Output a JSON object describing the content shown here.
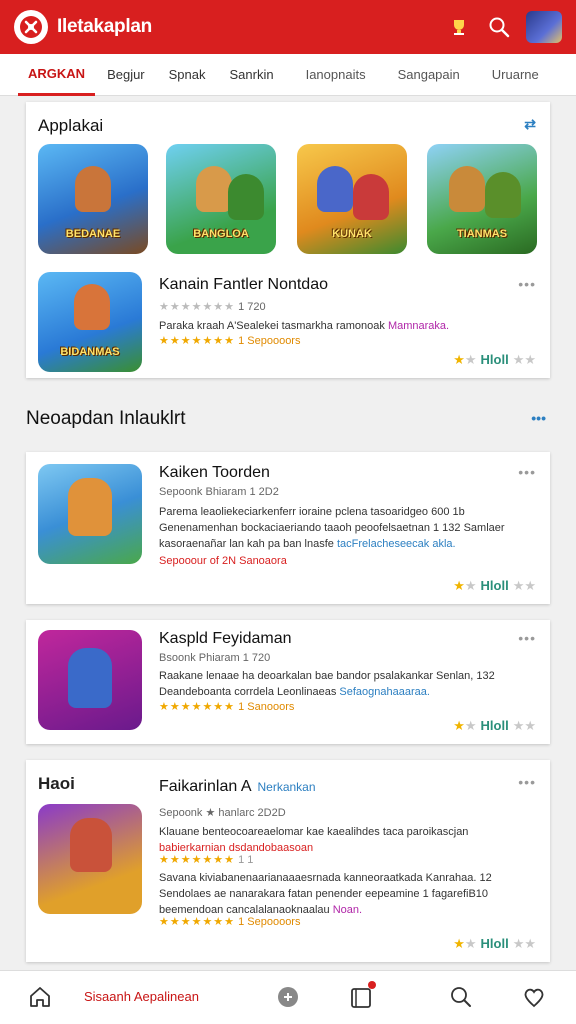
{
  "header": {
    "title": "Iletakaplan"
  },
  "tabs": [
    "ARGKAN",
    "Begjur",
    "Spnak",
    "Sanrkin",
    "Ianopnaits",
    "Sangapain",
    "Uruarne"
  ],
  "featured": {
    "title": "Applakai",
    "tiles": [
      {
        "label": "BEDANAE",
        "bg": "#3a8fe0"
      },
      {
        "label": "BANGLOA",
        "bg": "#2f9bd6"
      },
      {
        "label": "KUNAK",
        "bg": "#e9a02a"
      },
      {
        "label": "TIANMAS",
        "bg": "#3c8a2f"
      }
    ],
    "item": {
      "icon_label": "BIDANMAS",
      "title": "Kanain Fantler Nontdao",
      "meta": "1 720",
      "desc_plain": "Paraka kraah A'Sealekei tasmarkha ramonoak ",
      "desc_hl": "Mamnaraka.",
      "stars_text": "1 Sepoooors",
      "rating": "Hloll"
    }
  },
  "section": {
    "title": "Neoapdan Inlauklrt"
  },
  "list": [
    {
      "title": "Kaiken Toorden",
      "meta": "Sepoonk Bhiaram 1 2D2",
      "desc": "Parema leaoliekeciarkenferr ioraine pclena tasoaridgeo 600 1b Genenamenhan bockaciaeriando taaoh peoofelsaetnan 1 132 Samlaer kasoraenañar lan kah pa ban lnasfe ",
      "desc_hl": "tacFrelacheseecak akla.",
      "stars_text": "Sepooour of 2N Sanoaora",
      "rating": "Hloll"
    },
    {
      "title": "Kaspld Feyidaman",
      "meta": "Bsoonk Phiaram 1 720",
      "desc": "Raakane lenaae ha deoarkalan bae bandor psalakankar Senlan, 132 Deandeboanta corrdela Leonlinaeas ",
      "desc_hl": "Sefaognahaaaraa.",
      "stars_text": "1 Sanooors",
      "rating": "Hloll"
    },
    {
      "title": "Faikarinlan A",
      "tag": "Nerkankan",
      "side_label": "Haoi",
      "meta": "Sepoonk ★ hanlarc 2D2D",
      "desc": "Klauane benteocoareaelomar kae kaealihdes taca paroikascjan ",
      "desc_red": "babierkarnian dsdandobaasoan",
      "stars_text1": "1 1",
      "desc2": "Savana kiviabanenaarianaaaesrnada kanneoraatkada Kanrahaa. 12 Sendolaes ae nanarakara fatan penender eepeamine 1 fagarefiB10 beemendoan cancalalanaoknaalau ",
      "desc2_hl": "Noan.",
      "stars_text2": "1 Sepoooors",
      "rating": "Hloll"
    }
  ],
  "bottom_nav": {
    "active_label": "Sisaanh Aepalinean"
  },
  "colors": {
    "brand": "#d81f1f",
    "accent": "#2c7fc1",
    "star": "#f0b400"
  }
}
